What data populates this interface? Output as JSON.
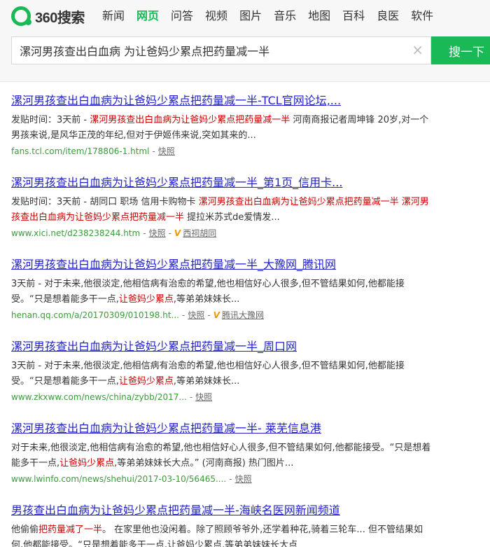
{
  "logo": {
    "text": "360搜索"
  },
  "nav": [
    "新闻",
    "网页",
    "问答",
    "视频",
    "图片",
    "音乐",
    "地图",
    "百科",
    "良医",
    "软件"
  ],
  "search": {
    "query": "漯河男孩查出白血病 为让爸妈少累点把药量减一半",
    "clear_icon": "×",
    "button_label": "搜一下"
  },
  "results": [
    {
      "title": "漯河男孩查出白血病为让爸妈少累点把药量减一半-TCL官网论坛,...",
      "snippet_prefix": "发贴时间：3天前 - ",
      "snippet_hl": "漯河男孩查出白血病为让爸妈少累点把药量减一半",
      "snippet_rest": " 河南商报记者周坤锋 20岁,对一个男孩来说,是风华正茂的年纪,但对于伊姬伟来说,突如其来的...",
      "url": "fans.tcl.com/item/178806-1.html",
      "cache": "快照"
    },
    {
      "title": "漯河男孩查出白血病为让爸妈少累点把药量减一半_第1页_信用卡...",
      "snippet_prefix": "发贴时间：3天前 - 胡同口 职场 信用卡购物卡 ",
      "snippet_hl": "漯河男孩查出白血病为让爸妈少累点把药量减一半 漯河男孩查出白血病为让爸妈少累点把药量减一半",
      "snippet_rest": " 提拉米苏式de爱情发...",
      "url": "www.xici.net/d238238244.htm",
      "cache": "快照",
      "source": "西祠胡同"
    },
    {
      "title": "漯河男孩查出白血病为让爸妈少累点把药量减一半_大豫网_腾讯网",
      "snippet_prefix": "3天前 - 对于未来,他很淡定,他相信病有治愈的希望,他也相信好心人很多,但不管结果如何,他都能接受。“只是想着能多干一点,",
      "snippet_hl": "让爸妈少累点",
      "snippet_rest": ",等弟弟妹妹长...",
      "url": "henan.qq.com/a/20170309/010198.ht...",
      "cache": "快照",
      "source": "腾讯大豫网"
    },
    {
      "title": "漯河男孩查出白血病为让爸妈少累点把药量减一半_周口网",
      "snippet_prefix": "3天前 - 对于未来,他很淡定,他相信病有治愈的希望,他也相信好心人很多,但不管结果如何,他都能接受。“只是想着能多干一点,",
      "snippet_hl": "让爸妈少累点",
      "snippet_rest": ",等弟弟妹妹长...",
      "url": "www.zkxww.com/news/china/zybb/2017...",
      "cache": "快照"
    },
    {
      "title": "漯河男孩查出白血病为让爸妈少累点把药量减一半- 莱芜信息港",
      "snippet_prefix": "对于未来,他很淡定,他相信病有治愈的希望,他也相信好心人很多,但不管结果如何,他都能接受。“只是想着能多干一点,",
      "snippet_hl": "让爸妈少累点",
      "snippet_rest": ",等弟弟妹妹长大点。” (河南商报) 热门图片...",
      "url": "www.lwinfo.com/news/shehui/2017-03-10/56465....",
      "cache": "快照"
    },
    {
      "title": "男孩查出白血病为让爸妈少累点把药量减一半-海峡名医网新闻频道",
      "snippet_prefix": "他偷偷",
      "snippet_hl": "把药量减了一半",
      "snippet_rest": "。 在家里他也没闲着。除了照顾爷爷外,还学着种花,骑着三轮车... 但不管结果如何,他都能接受。“只是想着能多干一点,让爸妈少累点,等弟弟妹妹长大点",
      "url": "",
      "cache": ""
    }
  ]
}
